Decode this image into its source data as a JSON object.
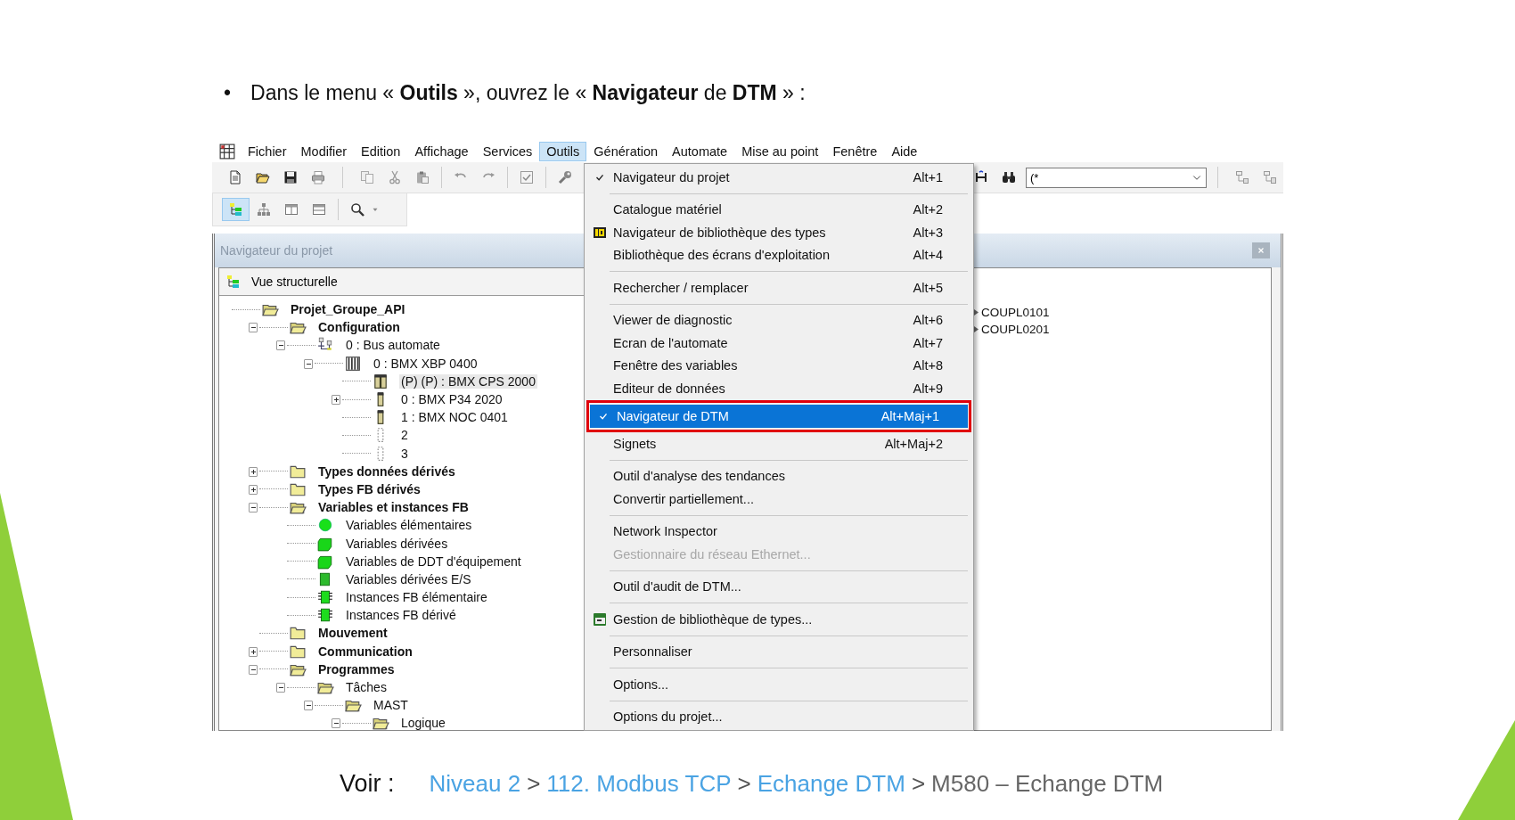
{
  "slide": {
    "bullet": "•",
    "instruction": "Dans le menu « **Outils** », ouvrez le « **Navigateur** de **DTM** » :",
    "footer": {
      "label": "Voir :",
      "path": [
        {
          "kind": "link",
          "text": "Niveau 2"
        },
        {
          "kind": "separator",
          "text": ">"
        },
        {
          "kind": "link",
          "text": "112. Modbus TCP"
        },
        {
          "kind": "separator",
          "text": ">"
        },
        {
          "kind": "link",
          "text": "Echange DTM"
        },
        {
          "kind": "separator",
          "text": ">"
        },
        {
          "kind": "current",
          "text": "M580 – Echange DTM"
        }
      ]
    }
  },
  "app": {
    "menubar": [
      {
        "label": "Fichier",
        "selected": false
      },
      {
        "label": "Modifier",
        "selected": false
      },
      {
        "label": "Edition",
        "selected": false
      },
      {
        "label": "Affichage",
        "selected": false
      },
      {
        "label": "Services",
        "selected": false
      },
      {
        "label": "Outils",
        "selected": true
      },
      {
        "label": "Génération",
        "selected": false
      },
      {
        "label": "Automate",
        "selected": false
      },
      {
        "label": "Mise au point",
        "selected": false
      },
      {
        "label": "Fenêtre",
        "selected": false
      },
      {
        "label": "Aide",
        "selected": false
      }
    ],
    "toolbar": {
      "combo_value": "(*",
      "view_buttons": [
        {
          "pressed": true
        },
        {
          "pressed": false
        },
        {
          "pressed": false
        },
        {
          "pressed": false
        }
      ]
    },
    "project_panel": {
      "title": "Navigateur du projet",
      "view_label": "Vue structurelle",
      "tree": [
        {
          "label": "Projet_Groupe_API",
          "kind": "folder",
          "selected": false,
          "children": [
            {
              "label": "Configuration",
              "kind": "folder",
              "expanded": true,
              "selected": false,
              "children": [
                {
                  "label": "0 : Bus automate",
                  "kind": "bus",
                  "expanded": true,
                  "selected": false,
                  "children": [
                    {
                      "label": "0 : BMX XBP 0400",
                      "kind": "rack",
                      "expanded": true,
                      "selected": false,
                      "children": [
                        {
                          "label": "(P) (P) : BMX CPS 2000",
                          "kind": "double-module",
                          "selected": true
                        },
                        {
                          "label": "0 : BMX P34 2020",
                          "kind": "module",
                          "expanded": false,
                          "selected": false
                        },
                        {
                          "label": "1 : BMX NOC 0401",
                          "kind": "module",
                          "selected": false
                        },
                        {
                          "label": "2",
                          "kind": "slot",
                          "selected": false
                        },
                        {
                          "label": "3",
                          "kind": "slot",
                          "selected": false
                        }
                      ]
                    }
                  ]
                }
              ]
            },
            {
              "label": "Types données dérivés",
              "kind": "folder",
              "expanded": false,
              "selected": false
            },
            {
              "label": "Types FB dérivés",
              "kind": "folder",
              "expanded": false,
              "selected": false
            },
            {
              "label": "Variables et instances FB",
              "kind": "folder",
              "expanded": true,
              "selected": false,
              "children": [
                {
                  "label": "Variables élémentaires",
                  "kind": "ball",
                  "selected": false
                },
                {
                  "label": "Variables dérivées",
                  "kind": "block",
                  "selected": false
                },
                {
                  "label": "Variables de DDT d'équipement",
                  "kind": "block",
                  "selected": false
                },
                {
                  "label": "Variables dérivées E/S",
                  "kind": "square",
                  "selected": false
                },
                {
                  "label": "Instances FB élémentaire",
                  "kind": "chip",
                  "selected": false
                },
                {
                  "label": "Instances FB dérivé",
                  "kind": "chip",
                  "selected": false
                }
              ]
            },
            {
              "label": "Mouvement",
              "kind": "folder",
              "selected": false
            },
            {
              "label": "Communication",
              "kind": "folder",
              "expanded": false,
              "selected": false
            },
            {
              "label": "Programmes",
              "kind": "folder",
              "expanded": true,
              "selected": false,
              "children": [
                {
                  "label": "Tâches",
                  "kind": "folder",
                  "expanded": true,
                  "selected": false,
                  "children": [
                    {
                      "label": "MAST",
                      "kind": "folder",
                      "expanded": true,
                      "selected": false,
                      "children": [
                        {
                          "label": "Logique",
                          "kind": "folder",
                          "expanded": true,
                          "selected": false
                        }
                      ]
                    }
                  ]
                }
              ]
            }
          ]
        }
      ]
    },
    "side_items": [
      "COUPL0101",
      "COUPL0201"
    ],
    "tools_menu": [
      {
        "kind": "item",
        "label": "Navigateur du projet",
        "shortcut": "Alt+1",
        "checked": true,
        "disabled": false,
        "selected": false,
        "framed": false
      },
      {
        "kind": "separator"
      },
      {
        "kind": "item",
        "label": "Catalogue matériel",
        "shortcut": "Alt+2",
        "checked": false,
        "disabled": false,
        "selected": false,
        "framed": false
      },
      {
        "kind": "icon-item",
        "label": "Navigateur de bibliothèque des types",
        "shortcut": "Alt+3",
        "checked": false,
        "disabled": false,
        "selected": false,
        "framed": false
      },
      {
        "kind": "item",
        "label": "Bibliothèque des écrans d'exploitation",
        "shortcut": "Alt+4",
        "checked": false,
        "disabled": false,
        "selected": false,
        "framed": false
      },
      {
        "kind": "separator"
      },
      {
        "kind": "item",
        "label": "Rechercher / remplacer",
        "shortcut": "Alt+5",
        "checked": false,
        "disabled": false,
        "selected": false,
        "framed": false
      },
      {
        "kind": "separator"
      },
      {
        "kind": "item",
        "label": "Viewer de diagnostic",
        "shortcut": "Alt+6",
        "checked": false,
        "disabled": false,
        "selected": false,
        "framed": false
      },
      {
        "kind": "item",
        "label": "Ecran de l'automate",
        "shortcut": "Alt+7",
        "checked": false,
        "disabled": false,
        "selected": false,
        "framed": false
      },
      {
        "kind": "item",
        "label": "Fenêtre des variables",
        "shortcut": "Alt+8",
        "checked": false,
        "disabled": false,
        "selected": false,
        "framed": false
      },
      {
        "kind": "item",
        "label": "Editeur de données",
        "shortcut": "Alt+9",
        "checked": false,
        "disabled": false,
        "selected": false,
        "framed": false
      },
      {
        "kind": "item",
        "label": "Navigateur de DTM",
        "shortcut": "Alt+Maj+1",
        "checked": true,
        "disabled": false,
        "selected": true,
        "framed": true
      },
      {
        "kind": "item",
        "label": "Signets",
        "shortcut": "Alt+Maj+2",
        "checked": false,
        "disabled": false,
        "selected": false,
        "framed": false
      },
      {
        "kind": "separator"
      },
      {
        "kind": "item",
        "label": "Outil d'analyse des tendances",
        "checked": false,
        "disabled": false,
        "selected": false,
        "framed": false
      },
      {
        "kind": "item",
        "label": "Convertir partiellement...",
        "checked": false,
        "disabled": false,
        "selected": false,
        "framed": false
      },
      {
        "kind": "separator"
      },
      {
        "kind": "item",
        "label": "Network Inspector",
        "checked": false,
        "disabled": false,
        "selected": false,
        "framed": false
      },
      {
        "kind": "item",
        "label": "Gestionnaire du réseau Ethernet...",
        "checked": false,
        "disabled": true,
        "selected": false,
        "framed": false
      },
      {
        "kind": "separator"
      },
      {
        "kind": "item",
        "label": "Outil d'audit de DTM...",
        "checked": false,
        "disabled": false,
        "selected": false,
        "framed": false
      },
      {
        "kind": "separator"
      },
      {
        "kind": "icon-item",
        "label": "Gestion de bibliothèque de types...",
        "checked": false,
        "disabled": false,
        "selected": false,
        "framed": false
      },
      {
        "kind": "separator"
      },
      {
        "kind": "item",
        "label": "Personnaliser",
        "checked": false,
        "disabled": false,
        "selected": false,
        "framed": false
      },
      {
        "kind": "separator"
      },
      {
        "kind": "item",
        "label": "Options...",
        "checked": false,
        "disabled": false,
        "selected": false,
        "framed": false
      },
      {
        "kind": "separator"
      },
      {
        "kind": "item",
        "label": "Options du projet...",
        "checked": false,
        "disabled": false,
        "selected": false,
        "framed": false
      }
    ]
  }
}
